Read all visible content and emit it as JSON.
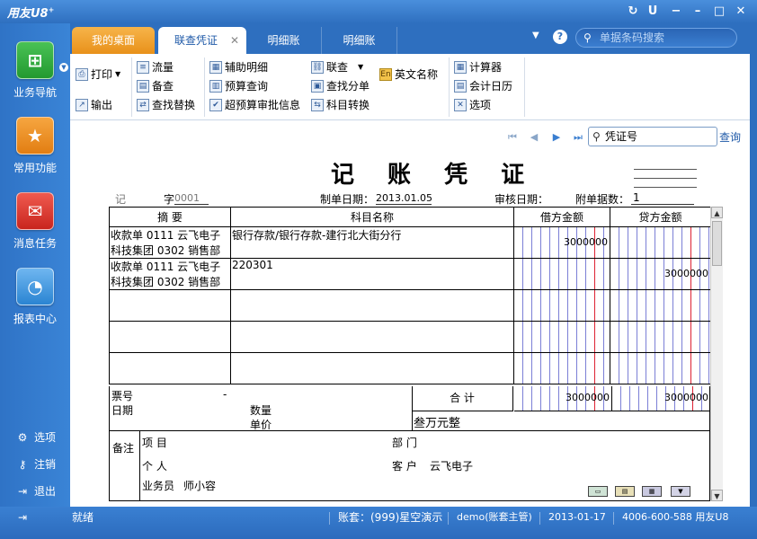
{
  "app": {
    "title": "用友U8",
    "title_sup": "+"
  },
  "window_controls": [
    "refresh-icon",
    "minimize-icon",
    "maximize-icon",
    "close-icon"
  ],
  "sidebar": {
    "items": [
      {
        "label": "业务导航",
        "icon": "tree-icon",
        "color": "#2fa83a"
      },
      {
        "label": "常用功能",
        "icon": "star-icon",
        "color": "#e88a1c"
      },
      {
        "label": "消息任务",
        "icon": "mail-icon",
        "color": "#d9322b"
      },
      {
        "label": "报表中心",
        "icon": "chart-icon",
        "color": "#2f8fd6"
      }
    ],
    "actions": [
      {
        "label": "选项",
        "icon": "gear-icon"
      },
      {
        "label": "注销",
        "icon": "key-icon"
      },
      {
        "label": "退出",
        "icon": "exit-icon"
      }
    ]
  },
  "tabs": [
    {
      "label": "我的桌面",
      "state": "home"
    },
    {
      "label": "联查凭证",
      "state": "active",
      "closable": true
    },
    {
      "label": "明细账",
      "state": "normal"
    },
    {
      "label": "明细账",
      "state": "normal"
    }
  ],
  "search": {
    "placeholder": "单据条码搜索"
  },
  "toolbar": {
    "print": "打印",
    "output": "输出",
    "flow": "流量",
    "backup": "备查",
    "find_replace": "查找替换",
    "aux_detail": "辅助明细",
    "budget_query": "预算查询",
    "over_budget": "超预算审批信息",
    "link_query": "联查",
    "find_entry": "查找分单",
    "subject_convert": "科目转换",
    "en_name": "英文名称",
    "calculator": "计算器",
    "calendar": "会计日历",
    "options": "选项"
  },
  "voucher_search": {
    "value": "凭证号",
    "query_label": "查询"
  },
  "voucher": {
    "title": "记 账 凭 证",
    "type": "记",
    "zi_label": "字",
    "number": "0001",
    "date_label": "制单日期：",
    "date": "2013.01.05",
    "audit_label": "审核日期：",
    "attach_label": "附单据数：",
    "attach_count": "1",
    "columns": {
      "summary": "摘 要",
      "account": "科目名称",
      "debit": "借方金额",
      "credit": "贷方金额"
    },
    "rows": [
      {
        "summary": "收款单 0111 云飞电子科技集团 0302 销售部",
        "account": "银行存款/银行存款-建行北大街分行",
        "debit": "3000000",
        "credit": ""
      },
      {
        "summary": "收款单 0111 云飞电子科技集团 0302 销售部",
        "account": "220301",
        "debit": "",
        "credit": "3000000"
      },
      {
        "summary": "",
        "account": "",
        "debit": "",
        "credit": ""
      },
      {
        "summary": "",
        "account": "",
        "debit": "",
        "credit": ""
      },
      {
        "summary": "",
        "account": "",
        "debit": "",
        "credit": ""
      }
    ],
    "footer": {
      "ticket_label": "票号",
      "ticket_value": "-",
      "date_label": "日期",
      "qty_label": "数量",
      "price_label": "单价",
      "total_label": "合 计",
      "total_debit": "3000000",
      "total_credit": "3000000",
      "amount_words": "叁万元整"
    },
    "remarks": {
      "label": "备注",
      "project_label": "项 目",
      "dept_label": "部 门",
      "person_label": "个 人",
      "customer_label": "客 户",
      "customer_value": "云飞电子",
      "salesman_label": "业务员",
      "salesman_value": "师小容"
    }
  },
  "statusbar": {
    "ready": "就绪",
    "account": "账套：(999)星空演示",
    "user": "demo(账套主管)",
    "date": "2013-01-17",
    "phone": "4006-600-588 用友U8"
  }
}
